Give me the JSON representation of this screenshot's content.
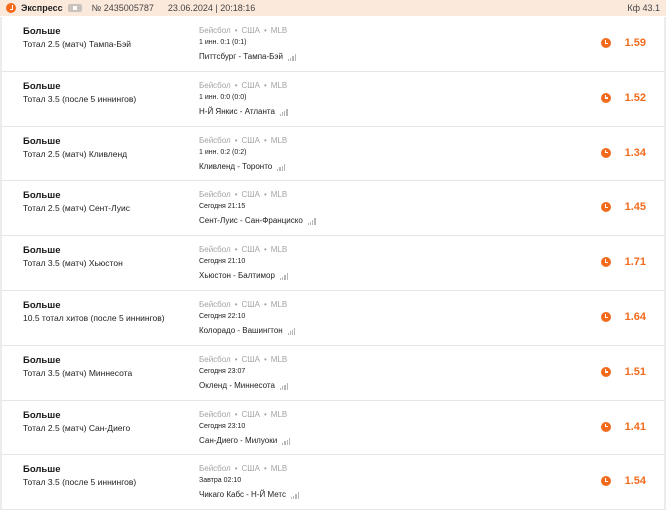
{
  "header": {
    "type": "Экспресс",
    "number": "№ 2435005787",
    "datetime": "23.06.2024 | 20:18:16",
    "coef": "Кф 43.1"
  },
  "accent_color": "#f26b1d",
  "events": [
    {
      "outcome": "Больше",
      "market": "Тотал 2.5 (матч) Тампа-Бэй",
      "sport": "Бейсбол",
      "country": "США",
      "league": "MLB",
      "status": "1 инн. 0:1 (0:1)",
      "match": "Питтсбург - Тампа-Бэй",
      "odd": "1.59"
    },
    {
      "outcome": "Больше",
      "market": "Тотал 3.5 (после 5 иннингов)",
      "sport": "Бейсбол",
      "country": "США",
      "league": "MLB",
      "status": "1 инн. 0:0 (0:0)",
      "match": "Н-Й Янкис - Атланта",
      "odd": "1.52"
    },
    {
      "outcome": "Больше",
      "market": "Тотал 2.5 (матч) Кливленд",
      "sport": "Бейсбол",
      "country": "США",
      "league": "MLB",
      "status": "1 инн. 0:2 (0:2)",
      "match": "Кливленд - Торонто",
      "odd": "1.34"
    },
    {
      "outcome": "Больше",
      "market": "Тотал 2.5 (матч) Сент-Луис",
      "sport": "Бейсбол",
      "country": "США",
      "league": "MLB",
      "status": "Сегодня 21:15",
      "match": "Сент-Луис - Сан-Франциско",
      "odd": "1.45"
    },
    {
      "outcome": "Больше",
      "market": "Тотал 3.5 (матч) Хьюстон",
      "sport": "Бейсбол",
      "country": "США",
      "league": "MLB",
      "status": "Сегодня 21:10",
      "match": "Хьюстон - Балтимор",
      "odd": "1.71"
    },
    {
      "outcome": "Больше",
      "market": "10.5 тотал хитов (после 5 иннингов)",
      "sport": "Бейсбол",
      "country": "США",
      "league": "MLB",
      "status": "Сегодня 22:10",
      "match": "Колорадо - Вашингтон",
      "odd": "1.64"
    },
    {
      "outcome": "Больше",
      "market": "Тотал 3.5 (матч) Миннесота",
      "sport": "Бейсбол",
      "country": "США",
      "league": "MLB",
      "status": "Сегодня 23:07",
      "match": "Окленд - Миннесота",
      "odd": "1.51"
    },
    {
      "outcome": "Больше",
      "market": "Тотал 2.5 (матч) Сан-Диего",
      "sport": "Бейсбол",
      "country": "США",
      "league": "MLB",
      "status": "Сегодня 23:10",
      "match": "Сан-Диего - Милуоки",
      "odd": "1.41"
    },
    {
      "outcome": "Больше",
      "market": "Тотал 3.5 (после 5 иннингов)",
      "sport": "Бейсбол",
      "country": "США",
      "league": "MLB",
      "status": "Завтра 02:10",
      "match": "Чикаго Кабс - Н-Й Метс",
      "odd": "1.54"
    }
  ]
}
